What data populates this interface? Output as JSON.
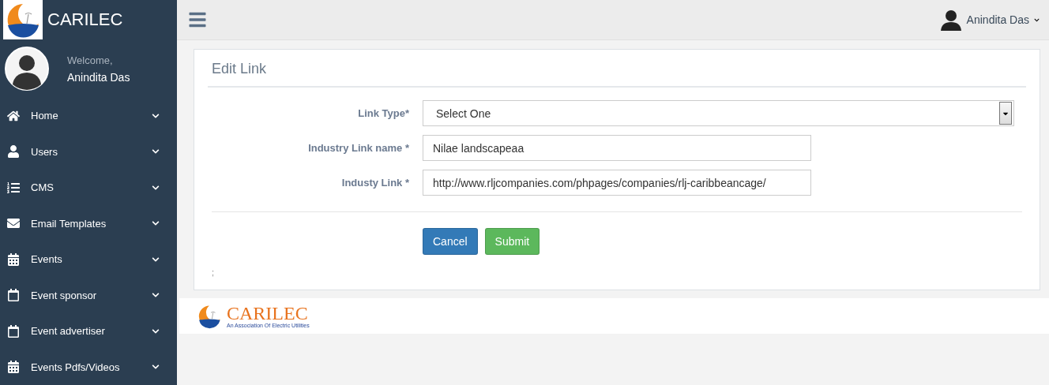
{
  "brand": "CARILEC",
  "profile": {
    "welcome": "Welcome,",
    "name": "Anindita Das"
  },
  "sidebar": {
    "items": [
      {
        "label": "Home"
      },
      {
        "label": "Users"
      },
      {
        "label": "CMS"
      },
      {
        "label": "Email Templates"
      },
      {
        "label": "Events"
      },
      {
        "label": "Event sponsor"
      },
      {
        "label": "Event advertiser"
      },
      {
        "label": "Events Pdfs/Videos"
      }
    ]
  },
  "topbar": {
    "user_name": "Anindita Das"
  },
  "form": {
    "title": "Edit Link",
    "fields": [
      {
        "kind": "select",
        "label": "Link Type*",
        "value": "Select One"
      },
      {
        "kind": "text",
        "label": "Industry Link name *",
        "value": "Nilae landscapeaa"
      },
      {
        "kind": "text",
        "label": "Industy Link *",
        "value": "http://www.rljcompanies.com/phpages/companies/rlj-caribbeancage/"
      }
    ],
    "buttons": [
      {
        "kind": "primary",
        "label": "Cancel"
      },
      {
        "kind": "success",
        "label": "Submit"
      }
    ],
    "note": ";"
  },
  "footer": {
    "brand": "CARILEC",
    "tagline": "An Association Of Electric Utilities"
  }
}
